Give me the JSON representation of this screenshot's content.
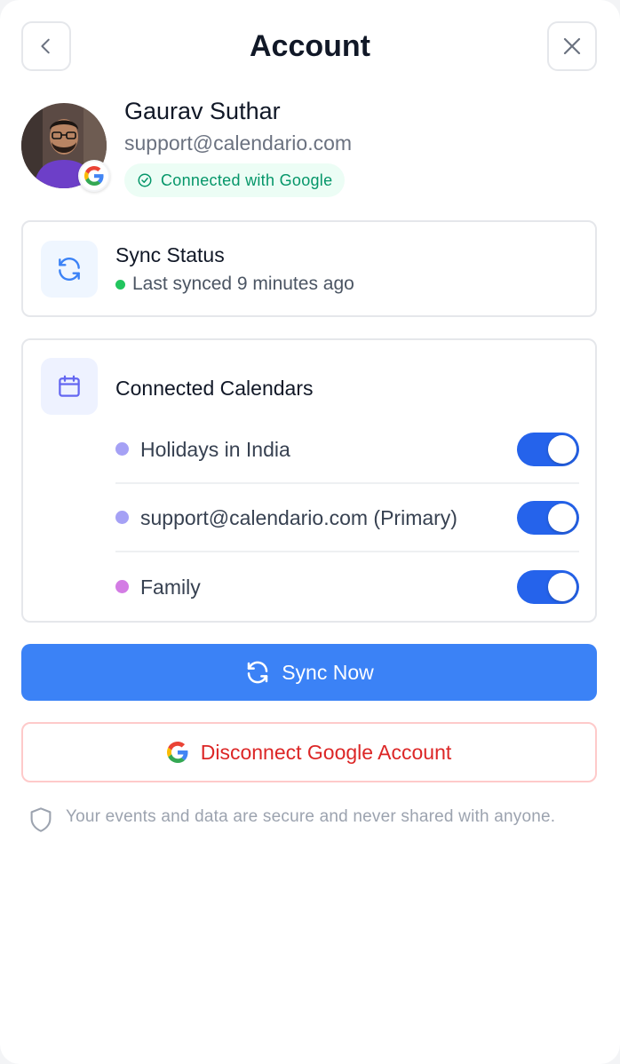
{
  "header": {
    "title": "Account",
    "back_icon": "chevron-left-icon",
    "close_icon": "close-icon"
  },
  "profile": {
    "name": "Gaurav Suthar",
    "email": "support@calendario.com",
    "connection_status": "Connected with Google",
    "badge_icon": "google-icon"
  },
  "sync_status": {
    "title": "Sync Status",
    "last_synced": "Last synced 9 minutes ago",
    "status_color": "#22c55e",
    "icon": "refresh-icon"
  },
  "calendars": {
    "title": "Connected Calendars",
    "icon": "calendar-icon",
    "items": [
      {
        "label": "Holidays in India",
        "color": "#a5a1f5",
        "enabled": true
      },
      {
        "label": "support@calendario.com (Primary)",
        "color": "#a5a1f5",
        "enabled": true
      },
      {
        "label": "Family",
        "color": "#d37ce4",
        "enabled": true
      }
    ]
  },
  "actions": {
    "sync_now_label": "Sync Now",
    "disconnect_label": "Disconnect Google Account"
  },
  "footer": {
    "security_note": "Your events and data are secure and never shared with anyone.",
    "icon": "shield-icon"
  },
  "colors": {
    "primary": "#3b82f6",
    "danger": "#dc2626",
    "success": "#059669",
    "toggle_on": "#2563eb"
  }
}
